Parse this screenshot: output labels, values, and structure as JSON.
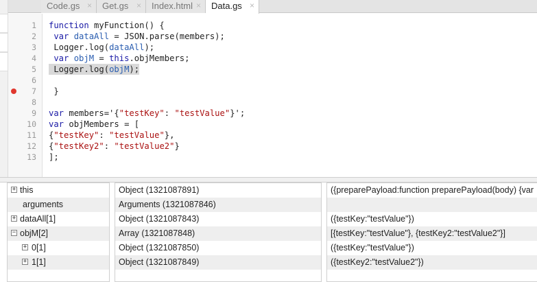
{
  "tabs": [
    {
      "label": "Code.gs",
      "active": false
    },
    {
      "label": "Get.gs",
      "active": false
    },
    {
      "label": "Index.html",
      "active": false
    },
    {
      "label": "Data.gs",
      "active": true
    }
  ],
  "close_glyph": "×",
  "editor": {
    "breakpoint_line": 5,
    "lines": [
      {
        "num": "1",
        "text": "function myFunction() {"
      },
      {
        "num": "2",
        "text": " var dataAll = JSON.parse(members);"
      },
      {
        "num": "3",
        "text": " Logger.log(dataAll);"
      },
      {
        "num": "4",
        "text": " var objM = this.objMembers;"
      },
      {
        "num": "5",
        "text": " Logger.log(objM);"
      },
      {
        "num": "6",
        "text": ""
      },
      {
        "num": "7",
        "text": " }"
      },
      {
        "num": "8",
        "text": ""
      },
      {
        "num": "9",
        "text": "var members='{\"testKey\": \"testValue\"}';"
      },
      {
        "num": "10",
        "text": "var objMembers = ["
      },
      {
        "num": "11",
        "text": "{\"testKey\": \"testValue\"},"
      },
      {
        "num": "12",
        "text": "{\"testKey2\": \"testValue2\"}"
      },
      {
        "num": "13",
        "text": "];"
      }
    ]
  },
  "debugger": {
    "rows": [
      {
        "expander": "+",
        "name": "this",
        "type": "Object (1321087891)",
        "value": "({preparePayload:function preparePayload(body) {var"
      },
      {
        "expander": "",
        "name": "arguments",
        "type": "Arguments (1321087846)",
        "value": ""
      },
      {
        "expander": "+",
        "name": "dataAll[1]",
        "type": "Object (1321087843)",
        "value": "({testKey:\"testValue\"})"
      },
      {
        "expander": "−",
        "name": "objM[2]",
        "type": "Array (1321087848)",
        "value": "[{testKey:\"testValue\"}, {testKey2:\"testValue2\"}]"
      },
      {
        "expander": "+",
        "name": "0[1]",
        "type": "Object (1321087850)",
        "value": "({testKey:\"testValue\"})"
      },
      {
        "expander": "+",
        "name": "1[1]",
        "type": "Object (1321087849)",
        "value": "({testKey2:\"testValue2\"})"
      }
    ]
  }
}
